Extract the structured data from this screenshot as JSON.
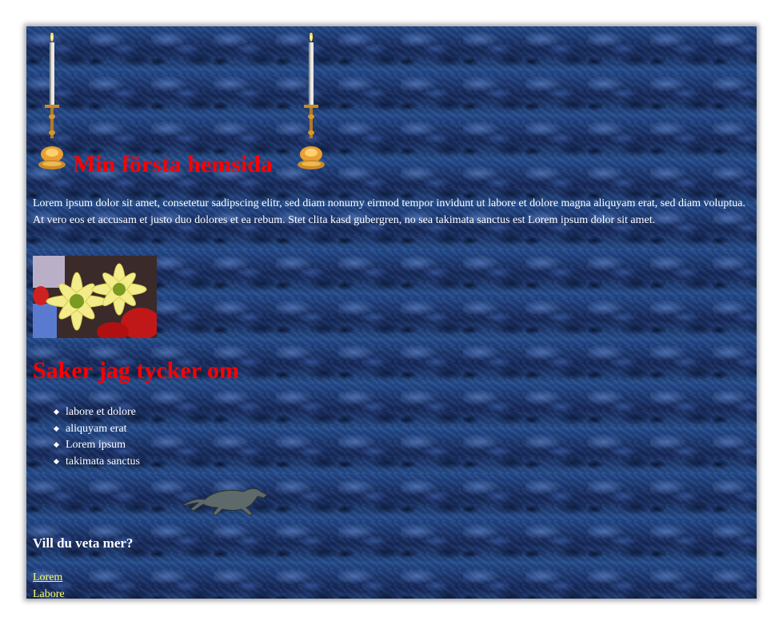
{
  "header": {
    "title": "Min första hemsida",
    "left_icon": "candle-icon",
    "right_icon": "candle-icon"
  },
  "intro_text": "Lorem ipsum dolor sit amet, consetetur sadipscing elitr, sed diam nonumy eirmod tempor invidunt ut labore et dolore magna aliquyam erat, sed diam voluptua. At vero eos et accusam et justo duo dolores et ea rebum. Stet clita kasd gubergren, no sea takimata sanctus est Lorem ipsum dolor sit amet.",
  "photo": {
    "subject": "yellow daisies with red flowers"
  },
  "section": {
    "title": "Saker jag tycker om",
    "items": [
      "labore et dolore",
      "aliquyam erat",
      "Lorem ipsum",
      "takimata sanctus"
    ]
  },
  "animation_icon": "running-greyhound-icon",
  "more": {
    "heading": "Vill du veta mer?",
    "links": [
      "Lorem",
      "Labore"
    ]
  },
  "colors": {
    "heading": "#ff0000",
    "body_text": "#ffffff",
    "link": "#ffff66",
    "background": "#1a2f5e"
  }
}
